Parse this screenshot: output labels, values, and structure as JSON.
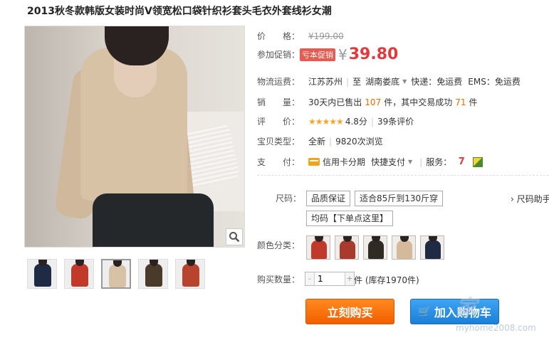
{
  "product": {
    "title": "2013秋冬款韩版女装时尚V领宽松口袋针织衫套头毛衣外套线衫女潮"
  },
  "price": {
    "label": "价　　格：",
    "original": "¥199.00",
    "promo_label": "参加促销：",
    "promo_tag": "亏本促销",
    "currency": "¥",
    "promo_price": "39.80"
  },
  "shipping": {
    "label": "物流运费：",
    "from": "江苏苏州",
    "to_prefix": "至",
    "to": "湖南娄底",
    "express": "快递：免运费",
    "ems": "EMS：免运费"
  },
  "sales": {
    "label": "销　　量：",
    "prefix": "30天内已售出",
    "sold": "107",
    "middle": "件，其中交易成功",
    "success": "71",
    "suffix": "件"
  },
  "rating": {
    "label": "评　　价：",
    "stars": "★★★★★",
    "score": "4.8分",
    "reviews": "39条评价"
  },
  "item_type": {
    "label": "宝贝类型：",
    "condition": "全新",
    "views": "9820次浏览"
  },
  "payment": {
    "label": "支　　付：",
    "credit": "信用卡分期",
    "quick": "快捷支付",
    "service_label": "服务：",
    "service_seven": "7"
  },
  "size": {
    "label": "尺码：",
    "options": [
      "品质保证",
      "适合85斤到130斤穿",
      "均码【下单点这里】"
    ],
    "help": "› 尺码助手"
  },
  "color": {
    "label": "颜色分类：",
    "swatches": [
      "#c0392b",
      "#a83a2e",
      "#2f2a24",
      "#d4b99a",
      "#1f2a44"
    ]
  },
  "thumbs": {
    "colors": [
      "#1f2a44",
      "#c0392b",
      "#d8c2a6",
      "#4a3a2c",
      "#b8442e"
    ]
  },
  "quantity": {
    "label": "购买数量：",
    "minus": "-",
    "value": "1",
    "plus": "+",
    "stock": "件 (库存1970件)"
  },
  "actions": {
    "buy": "立刻购买",
    "cart": "加入购物车",
    "cart_icon": "🛒"
  },
  "watermark": {
    "main": "家",
    "url": "myhome2008.com"
  },
  "colors": {
    "accent_orange": "#f35e00",
    "price_red": "#e4393c",
    "cart_blue": "#1a7fd8"
  }
}
